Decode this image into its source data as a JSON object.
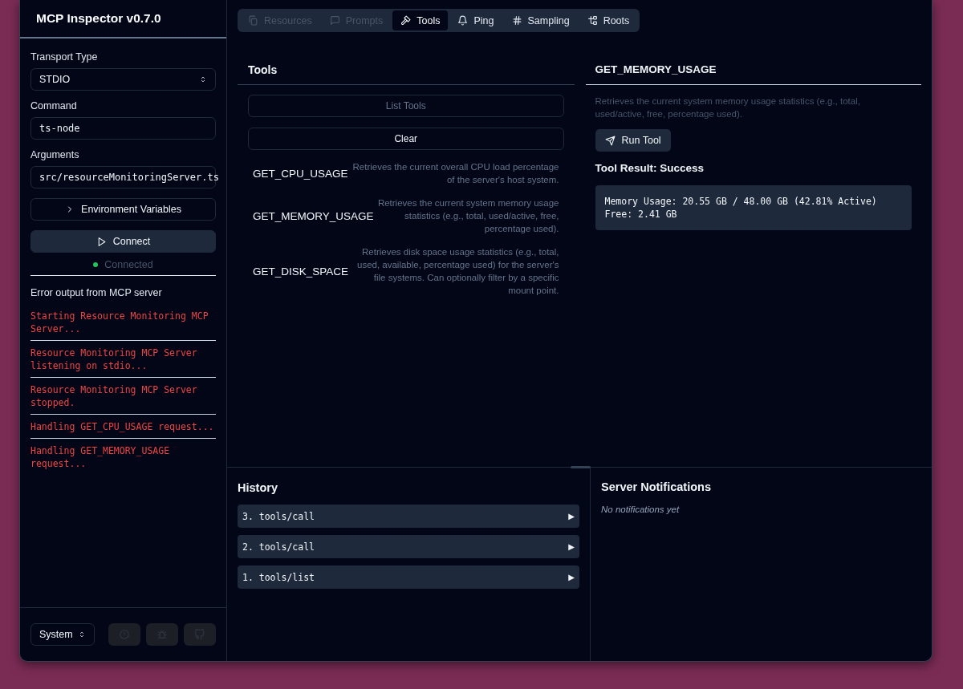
{
  "sidebar": {
    "title": "MCP Inspector v0.7.0",
    "transport_label": "Transport Type",
    "transport": "STDIO",
    "command_label": "Command",
    "command": "ts-node",
    "arguments_label": "Arguments",
    "arguments": "src/resourceMonitoringServer.ts",
    "env_button": "Environment Variables",
    "connect_button": "Connect",
    "status": "Connected",
    "connected": true,
    "error_title": "Error output from MCP server",
    "error_lines": [
      "Starting Resource Monitoring MCP Server...",
      "Resource Monitoring MCP Server listening on stdio...",
      "Resource Monitoring MCP Server stopped.",
      "Handling GET_CPU_USAGE request...",
      "Handling GET_MEMORY_USAGE request..."
    ],
    "theme": "System",
    "footer_buttons": [
      {
        "kind": "circle",
        "disabled": true
      },
      {
        "kind": "bug",
        "disabled": true
      },
      {
        "kind": "cat",
        "disabled": true
      }
    ]
  },
  "tabs": [
    {
      "label": "Resources",
      "kind": "files",
      "disabled": true,
      "selected": false
    },
    {
      "label": "Prompts",
      "kind": "message",
      "disabled": true,
      "selected": false
    },
    {
      "label": "Tools",
      "kind": "hammer",
      "disabled": false,
      "selected": true
    },
    {
      "label": "Ping",
      "kind": "bell",
      "disabled": false,
      "selected": false
    },
    {
      "label": "Sampling",
      "kind": "hash",
      "disabled": false,
      "selected": false
    },
    {
      "label": "Roots",
      "kind": "tree",
      "disabled": false,
      "selected": false
    }
  ],
  "tools": {
    "title": "Tools",
    "list_button": "List Tools",
    "list_disabled": true,
    "clear_button": "Clear",
    "items": [
      {
        "name": "GET_CPU_USAGE",
        "description": "Retrieves the current overall CPU load percentage of the server's host system."
      },
      {
        "name": "GET_MEMORY_USAGE",
        "description": "Retrieves the current system memory usage statistics (e.g., total, used/active, free, percentage used)."
      },
      {
        "name": "GET_DISK_SPACE",
        "description": "Retrieves disk space usage statistics (e.g., total, used, available, percentage used) for the server's file systems. Can optionally filter by a specific mount point."
      }
    ]
  },
  "detail": {
    "title": "GET_MEMORY_USAGE",
    "description": "Retrieves the current system memory usage statistics (e.g., total, used/active, free, percentage used).",
    "run_button": "Run Tool",
    "result_title": "Tool Result: Success",
    "result_lines": [
      "Memory Usage: 20.55 GB / 48.00 GB (42.81% Active)",
      "Free: 2.41 GB"
    ]
  },
  "history": {
    "title": "History",
    "items": [
      {
        "label": "3. tools/call",
        "toggle": "▶"
      },
      {
        "label": "2. tools/call",
        "toggle": "▶"
      },
      {
        "label": "1. tools/list",
        "toggle": "▶"
      }
    ]
  },
  "notifications": {
    "title": "Server Notifications",
    "empty": "No notifications yet"
  }
}
